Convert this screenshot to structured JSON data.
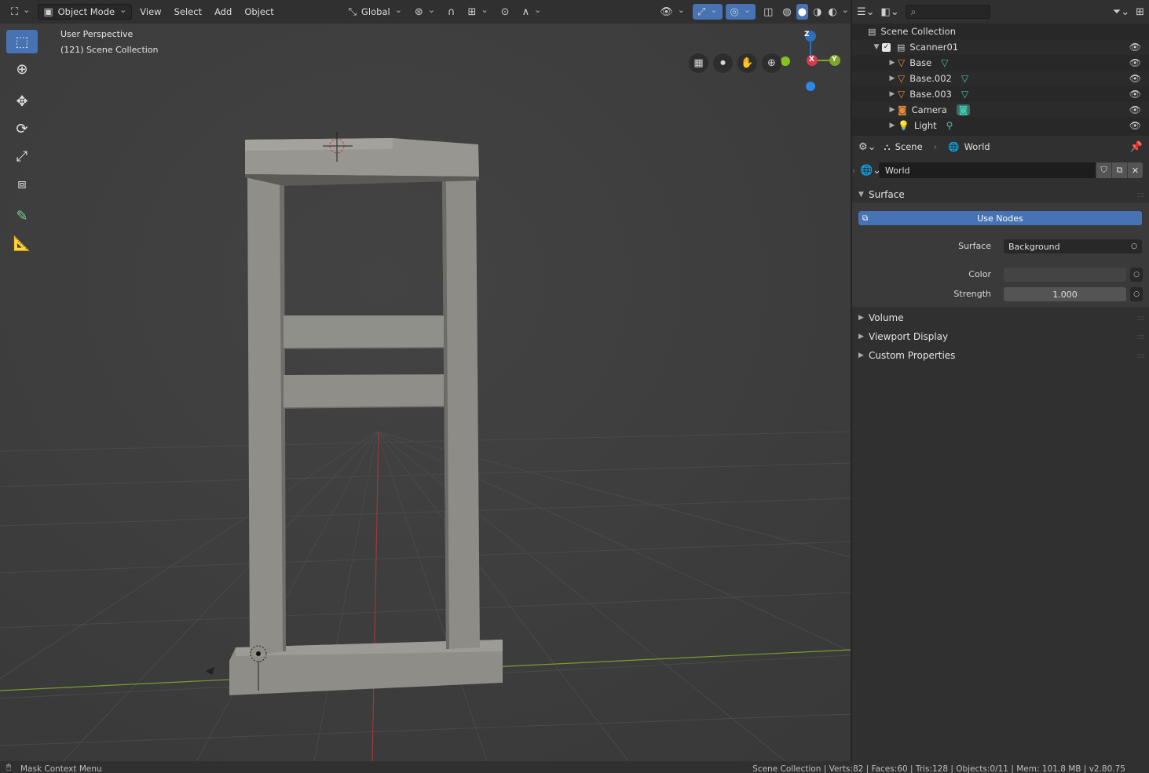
{
  "header": {
    "mode_label": "Object Mode",
    "menus": [
      "View",
      "Select",
      "Add",
      "Object"
    ],
    "transform_orientation": "Global"
  },
  "viewport": {
    "perspective_label": "User Perspective",
    "collection_label": "(121) Scene Collection",
    "gizmo": {
      "z": "Z",
      "x": "X",
      "y": "Y"
    },
    "colors": {
      "grid": "#4a4a4a",
      "x_axis": "#9b3a3a",
      "y_axis": "#7d9b2e",
      "object": "#8f8f8a"
    }
  },
  "outliner": {
    "search_placeholder": "",
    "root": "Scene Collection",
    "collection": "Scanner01",
    "items": [
      {
        "name": "Base",
        "type": "mesh"
      },
      {
        "name": "Base.002",
        "type": "mesh"
      },
      {
        "name": "Base.003",
        "type": "mesh"
      },
      {
        "name": "Camera",
        "type": "camera"
      },
      {
        "name": "Light",
        "type": "light"
      }
    ]
  },
  "properties": {
    "breadcrumb_scene": "Scene",
    "breadcrumb_world": "World",
    "world_name": "World",
    "surface_panel": "Surface",
    "use_nodes_label": "Use Nodes",
    "surface_label": "Surface",
    "surface_value": "Background",
    "color_label": "Color",
    "strength_label": "Strength",
    "strength_value": "1.000",
    "collapsed_panels": [
      "Volume",
      "Viewport Display",
      "Custom Properties"
    ]
  },
  "status": {
    "left": "Mask Context Menu",
    "right": "Scene Collection | Verts:82 | Faces:60 | Tris:128 | Objects:0/11 | Mem: 101.8 MB | v2.80.75"
  }
}
